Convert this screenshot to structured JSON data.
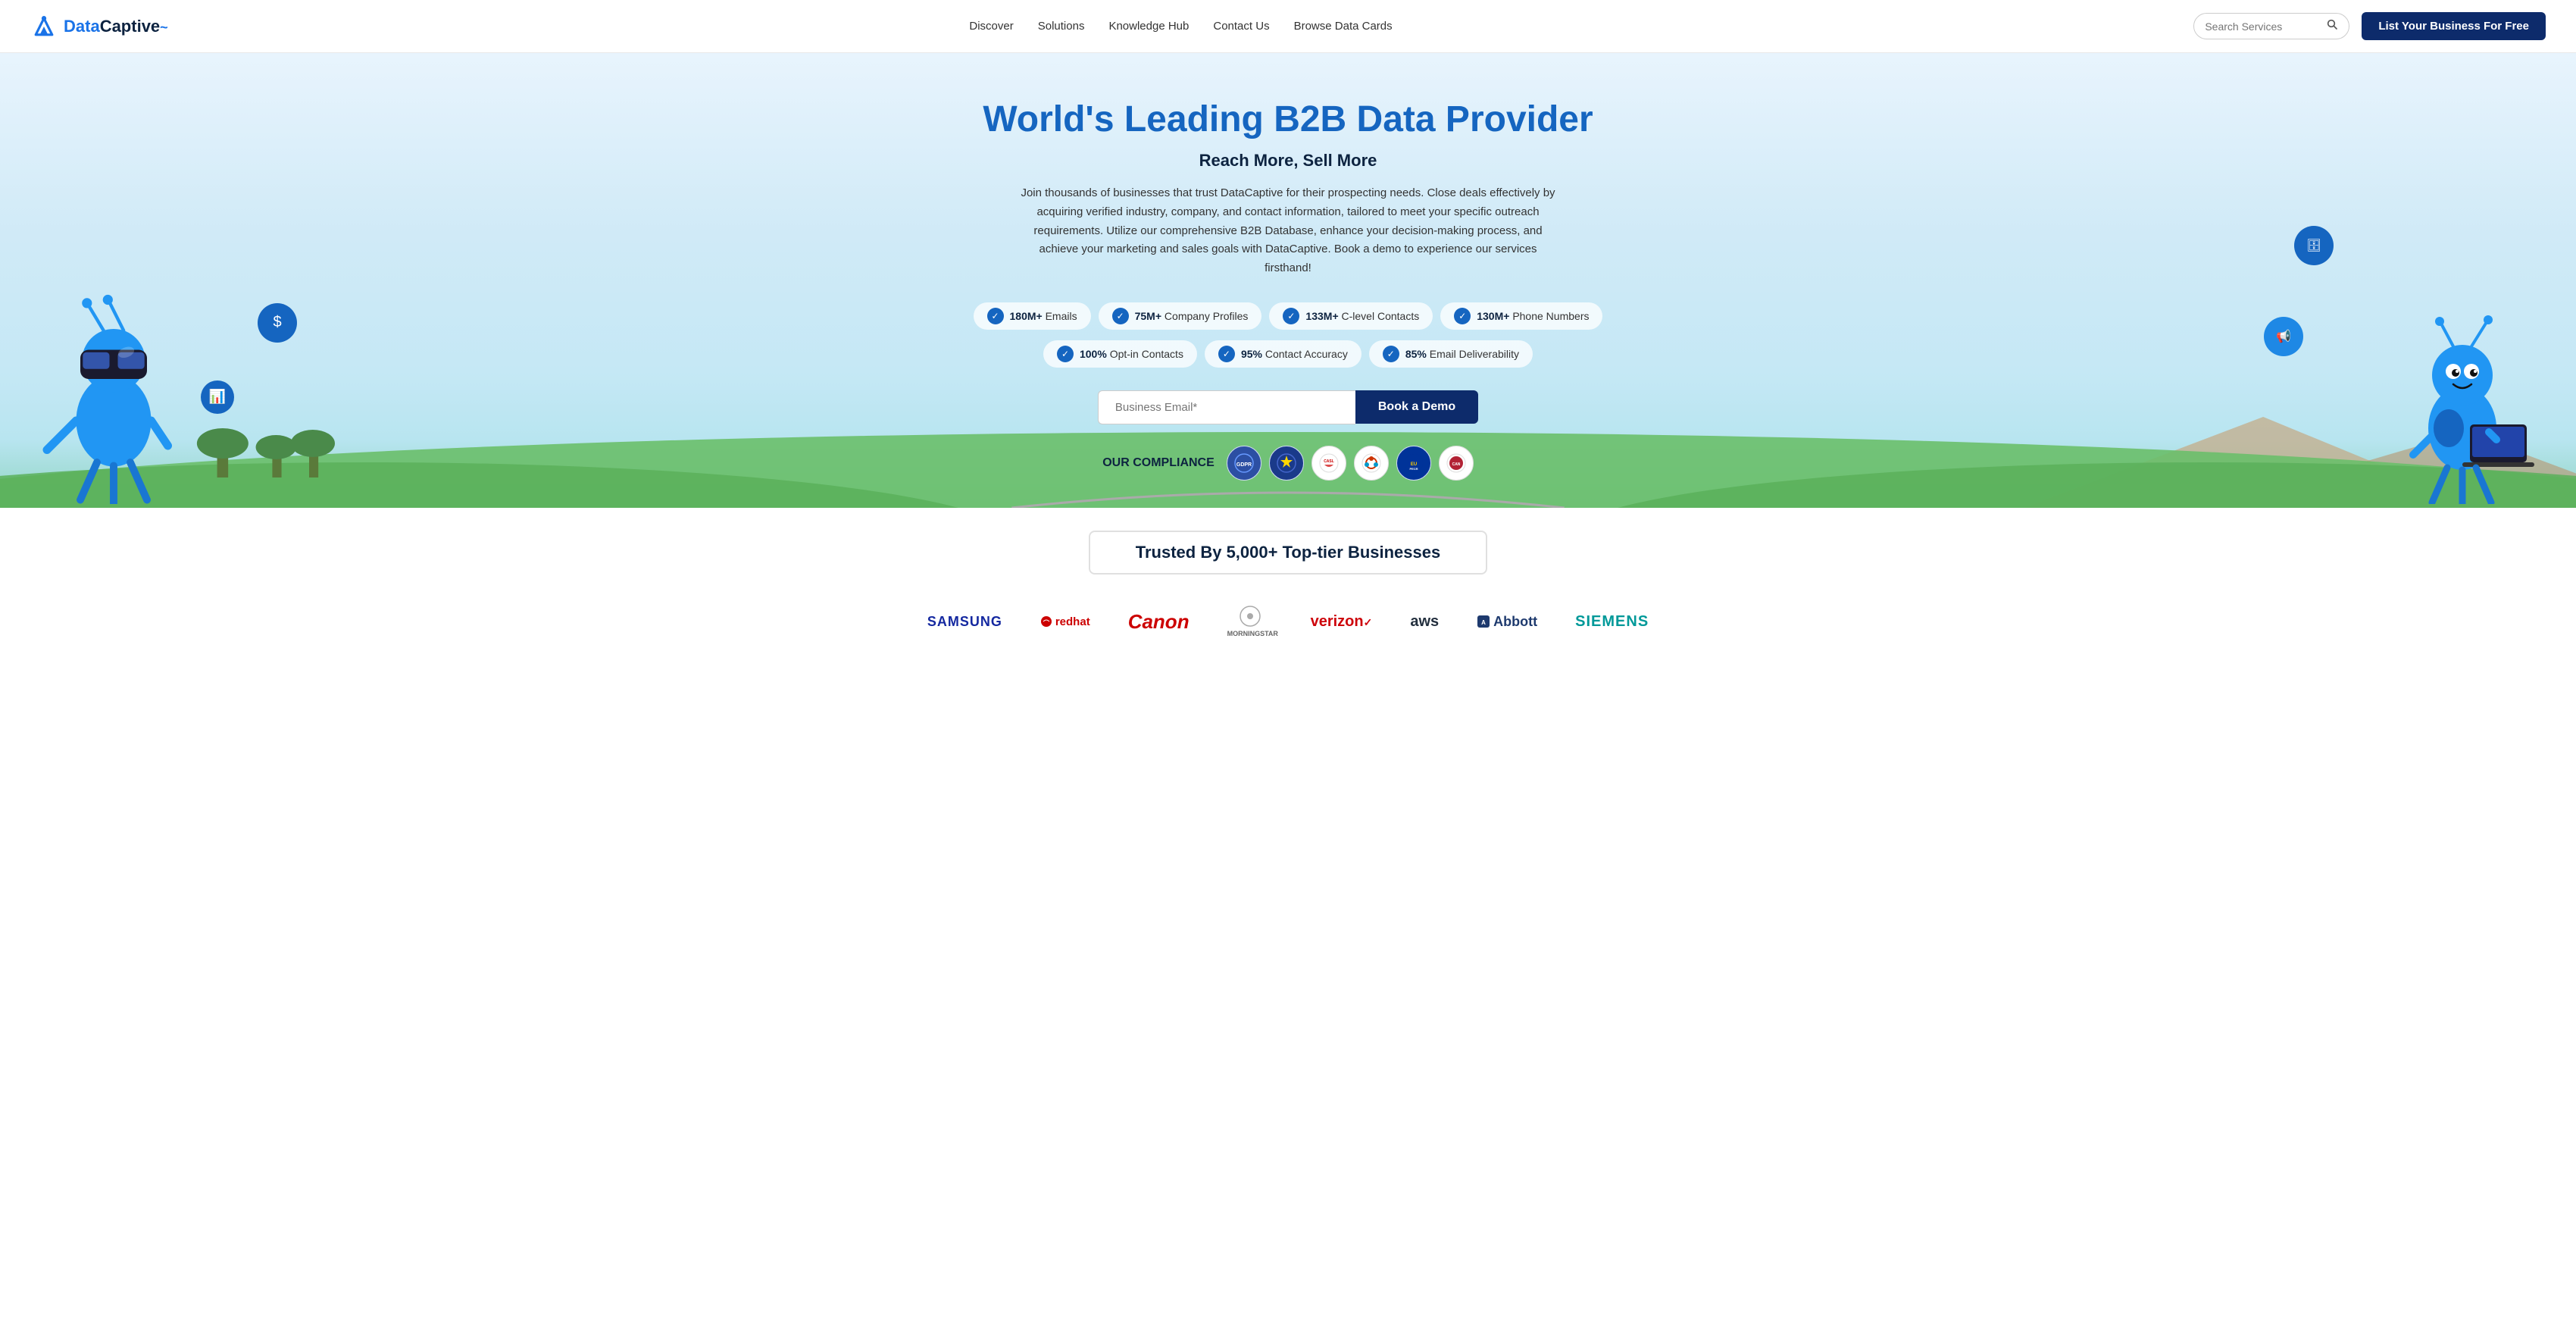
{
  "navbar": {
    "logo_text_data": "Data",
    "logo_text_captive": "Captive",
    "nav_links": [
      {
        "label": "Discover",
        "id": "nav-discover"
      },
      {
        "label": "Solutions",
        "id": "nav-solutions"
      },
      {
        "label": "Knowledge Hub",
        "id": "nav-knowledge-hub"
      },
      {
        "label": "Contact Us",
        "id": "nav-contact"
      },
      {
        "label": "Browse Data Cards",
        "id": "nav-browse"
      }
    ],
    "search_placeholder": "Search Services",
    "cta_label": "List Your Business For Free"
  },
  "hero": {
    "headline": "World's Leading B2B Data Provider",
    "subheadline": "Reach More, Sell More",
    "body": "Join thousands of businesses that trust DataCaptive for their prospecting needs. Close deals effectively by acquiring verified industry, company, and contact information, tailored to meet your specific outreach requirements. Utilize our comprehensive B2B Database, enhance your decision-making process, and achieve your marketing and sales goals with DataCaptive. Book a demo to experience our services firsthand!",
    "stats_row1": [
      {
        "value": "180M+",
        "label": "Emails"
      },
      {
        "value": "75M+",
        "label": "Company Profiles"
      },
      {
        "value": "133M+",
        "label": "C-level Contacts"
      },
      {
        "value": "130M+",
        "label": "Phone Numbers"
      }
    ],
    "stats_row2": [
      {
        "value": "100%",
        "label": "Opt-in Contacts"
      },
      {
        "value": "95%",
        "label": "Contact Accuracy"
      },
      {
        "value": "85%",
        "label": "Email Deliverability"
      }
    ],
    "email_placeholder": "Business Email*",
    "book_demo_label": "Book a Demo",
    "compliance_label": "OUR COMPLIANCE",
    "compliance_badges": [
      "GDPR",
      "CCPA",
      "CASL",
      "POPI",
      "PECR",
      "CAN-SPAM"
    ]
  },
  "trusted": {
    "banner": "Trusted By 5,000+ Top-tier Businesses",
    "brands": [
      {
        "name": "Samsung",
        "style": "samsung"
      },
      {
        "name": "Red Hat",
        "style": "redhat"
      },
      {
        "name": "Canon",
        "style": "canon"
      },
      {
        "name": "Morning Star",
        "style": "ms"
      },
      {
        "name": "Verizon",
        "style": "verizon"
      },
      {
        "name": "AWS",
        "style": "aws"
      },
      {
        "name": "Abbott",
        "style": "abbott"
      },
      {
        "name": "SIEMENS",
        "style": "siemens"
      }
    ]
  }
}
